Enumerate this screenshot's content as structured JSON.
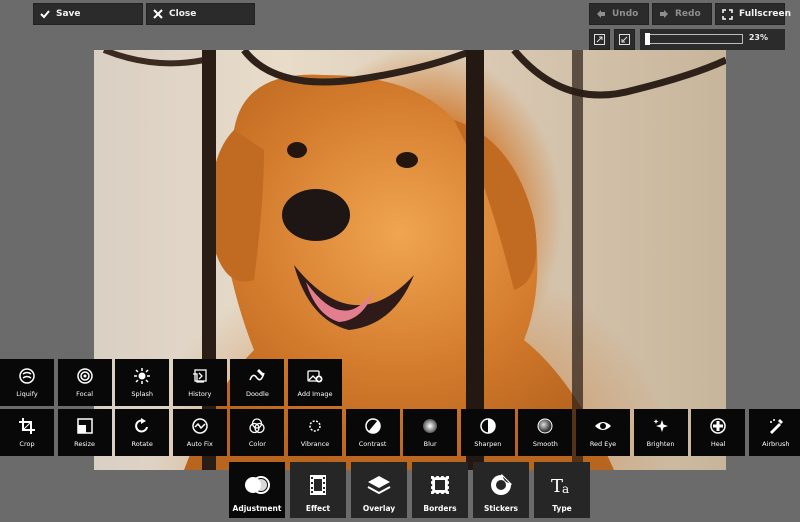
{
  "topbar": {
    "save_label": "Save",
    "close_label": "Close",
    "undo_label": "Undo",
    "redo_label": "Redo",
    "fullscreen_label": "Fullscreen"
  },
  "zoom": {
    "value_label": "23%",
    "level_fraction": 0.0
  },
  "tools_row1": [
    {
      "label": "Liquify",
      "icon": "liquify-icon"
    },
    {
      "label": "Focal",
      "icon": "focal-icon"
    },
    {
      "label": "Splash",
      "icon": "splash-icon"
    },
    {
      "label": "History",
      "icon": "history-icon"
    },
    {
      "label": "Doodle",
      "icon": "doodle-icon"
    },
    {
      "label": "Add Image",
      "icon": "add-image-icon"
    }
  ],
  "tools_row2": [
    {
      "label": "Crop",
      "icon": "crop-icon"
    },
    {
      "label": "Resize",
      "icon": "resize-icon"
    },
    {
      "label": "Rotate",
      "icon": "rotate-icon"
    },
    {
      "label": "Auto Fix",
      "icon": "auto-fix-icon"
    },
    {
      "label": "Color",
      "icon": "color-icon"
    },
    {
      "label": "Vibrance",
      "icon": "vibrance-icon"
    },
    {
      "label": "Contrast",
      "icon": "contrast-icon"
    },
    {
      "label": "Blur",
      "icon": "blur-icon"
    },
    {
      "label": "Sharpen",
      "icon": "sharpen-icon"
    },
    {
      "label": "Smooth",
      "icon": "smooth-icon"
    },
    {
      "label": "Red Eye",
      "icon": "red-eye-icon"
    },
    {
      "label": "Brighten",
      "icon": "brighten-icon"
    },
    {
      "label": "Heal",
      "icon": "heal-icon"
    },
    {
      "label": "Airbrush",
      "icon": "airbrush-icon"
    }
  ],
  "categories": [
    {
      "label": "Adjustment",
      "icon": "adjustment-icon",
      "active": true
    },
    {
      "label": "Effect",
      "icon": "effect-icon",
      "active": false
    },
    {
      "label": "Overlay",
      "icon": "overlay-icon",
      "active": false
    },
    {
      "label": "Borders",
      "icon": "borders-icon",
      "active": false
    },
    {
      "label": "Stickers",
      "icon": "stickers-icon",
      "active": false
    },
    {
      "label": "Type",
      "icon": "type-icon",
      "active": false
    }
  ],
  "colors": {
    "background": "#6b6b6b",
    "button_bg": "#2b2b2b",
    "tool_bg": "#080808",
    "disabled_text": "#8e8e8e"
  }
}
